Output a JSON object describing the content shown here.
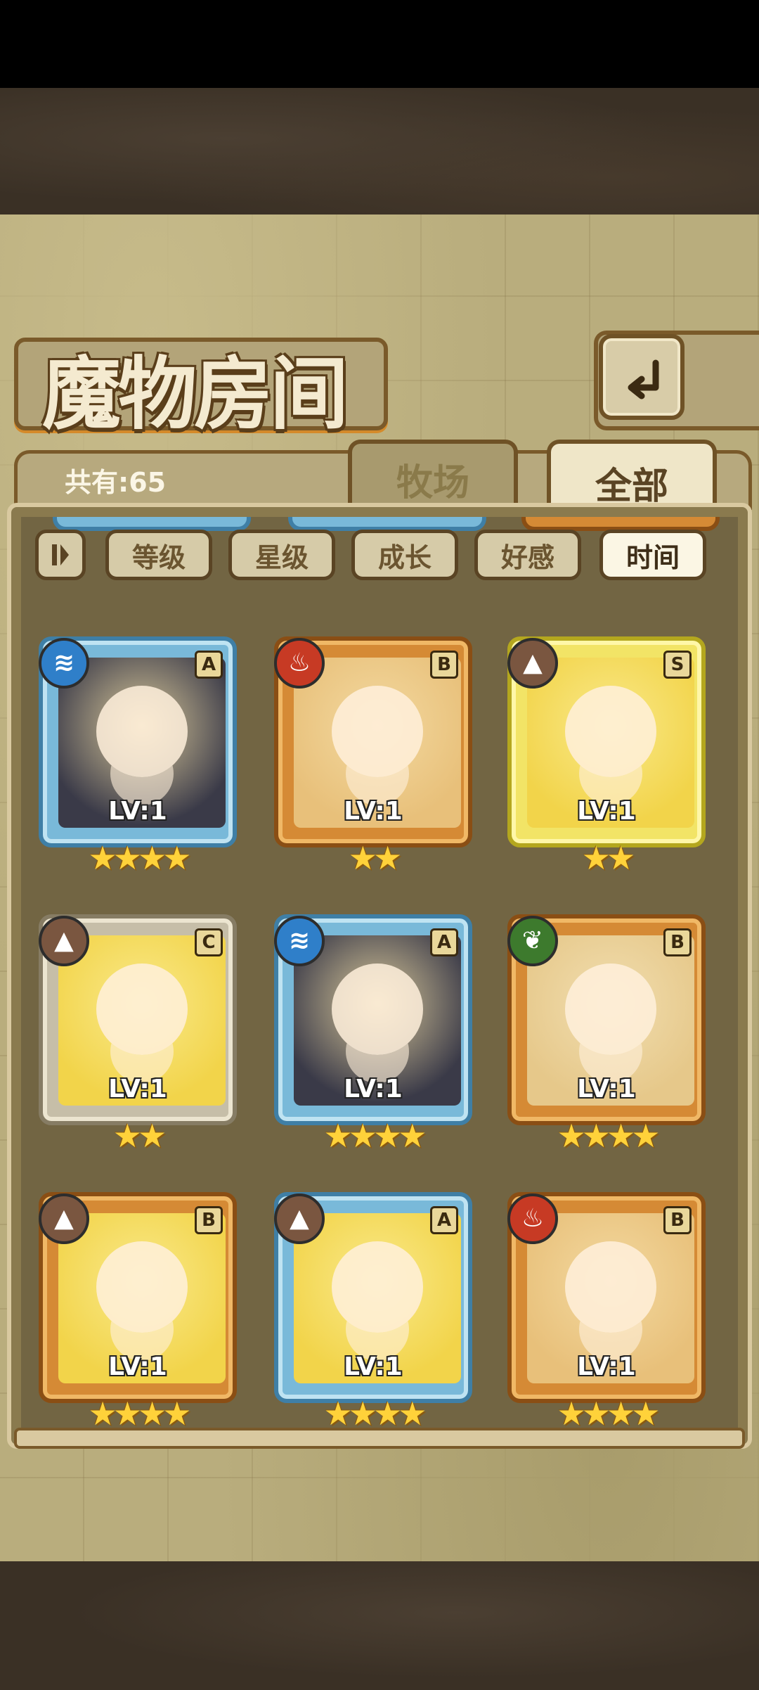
{
  "title": "魔物房间",
  "count_label": "共有:65",
  "tabs": [
    {
      "label": "牧场",
      "active": false
    },
    {
      "label": "全部",
      "active": true
    }
  ],
  "sort_buttons": [
    {
      "label": "等级",
      "active": false
    },
    {
      "label": "星级",
      "active": false
    },
    {
      "label": "成长",
      "active": false
    },
    {
      "label": "好感",
      "active": false
    },
    {
      "label": "时间",
      "active": true
    }
  ],
  "monsters": [
    {
      "level": "LV:1",
      "rank": "A",
      "element": "water",
      "stars": 4,
      "frame": "blue"
    },
    {
      "level": "LV:1",
      "rank": "B",
      "element": "fire",
      "stars": 2,
      "frame": "orange"
    },
    {
      "level": "LV:1",
      "rank": "S",
      "element": "earth",
      "stars": 2,
      "frame": "yellow"
    },
    {
      "level": "LV:1",
      "rank": "C",
      "element": "earth",
      "stars": 2,
      "frame": "gray"
    },
    {
      "level": "LV:1",
      "rank": "A",
      "element": "water",
      "stars": 4,
      "frame": "blue"
    },
    {
      "level": "LV:1",
      "rank": "B",
      "element": "leaf",
      "stars": 4,
      "frame": "orange"
    },
    {
      "level": "LV:1",
      "rank": "B",
      "element": "earth",
      "stars": 4,
      "frame": "orange"
    },
    {
      "level": "LV:1",
      "rank": "A",
      "element": "earth",
      "stars": 4,
      "frame": "blue"
    },
    {
      "level": "LV:1",
      "rank": "B",
      "element": "fire",
      "stars": 4,
      "frame": "orange"
    }
  ],
  "colors": {
    "gold_star": "#ffd23a",
    "panel_brown": "#726543",
    "map_tan": "#b9ad7d"
  },
  "icons": {
    "back": "back-arrow-icon",
    "sort_toggle": "sort-order-icon"
  }
}
